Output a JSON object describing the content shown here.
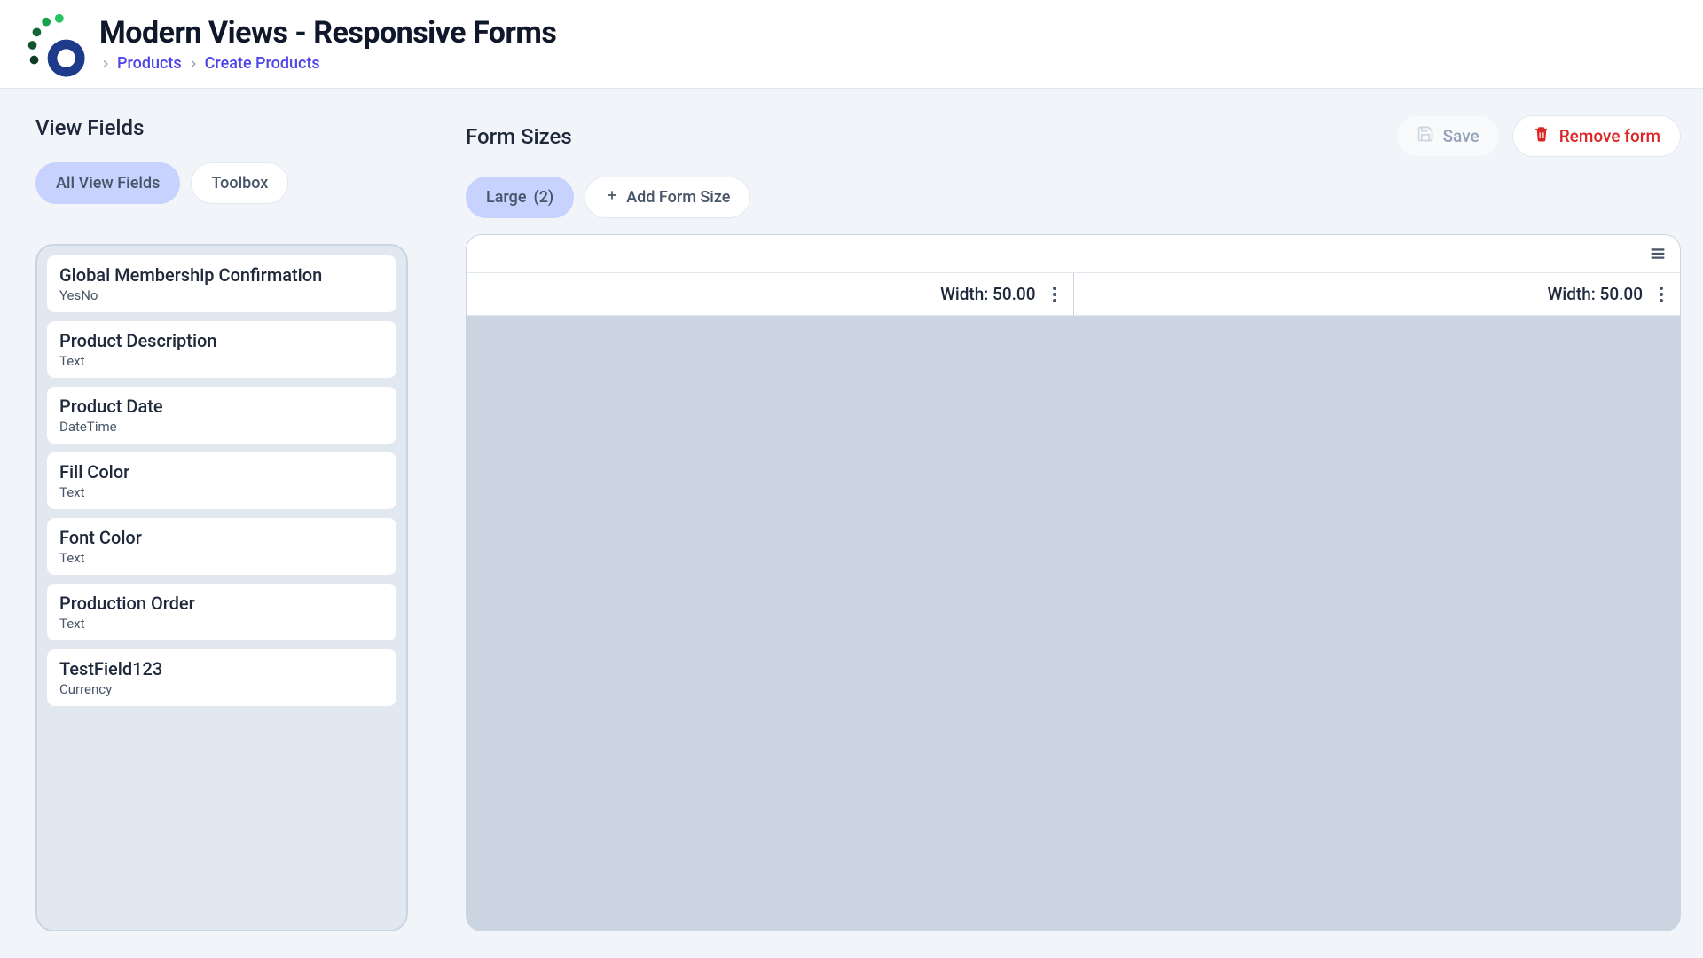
{
  "header": {
    "title": "Modern Views - Responsive Forms",
    "breadcrumb": [
      {
        "label": "Products"
      },
      {
        "label": "Create Products"
      }
    ]
  },
  "left": {
    "title": "View Fields",
    "tabs": {
      "all": "All View Fields",
      "toolbox": "Toolbox"
    },
    "fields": [
      {
        "name": "Global Membership Confirmation",
        "type": "YesNo"
      },
      {
        "name": "Product Description",
        "type": "Text"
      },
      {
        "name": "Product Date",
        "type": "DateTime"
      },
      {
        "name": "Fill Color",
        "type": "Text"
      },
      {
        "name": "Font Color",
        "type": "Text"
      },
      {
        "name": "Production Order",
        "type": "Text"
      },
      {
        "name": "TestField123",
        "type": "Currency"
      }
    ]
  },
  "right": {
    "title": "Form Sizes",
    "buttons": {
      "save": "Save",
      "remove": "Remove form",
      "addSize": "Add Form Size"
    },
    "sizeTabs": [
      {
        "label": "Large",
        "count": "(2)"
      }
    ],
    "columns": [
      {
        "widthLabel": "Width: 50.00"
      },
      {
        "widthLabel": "Width: 50.00"
      }
    ]
  }
}
